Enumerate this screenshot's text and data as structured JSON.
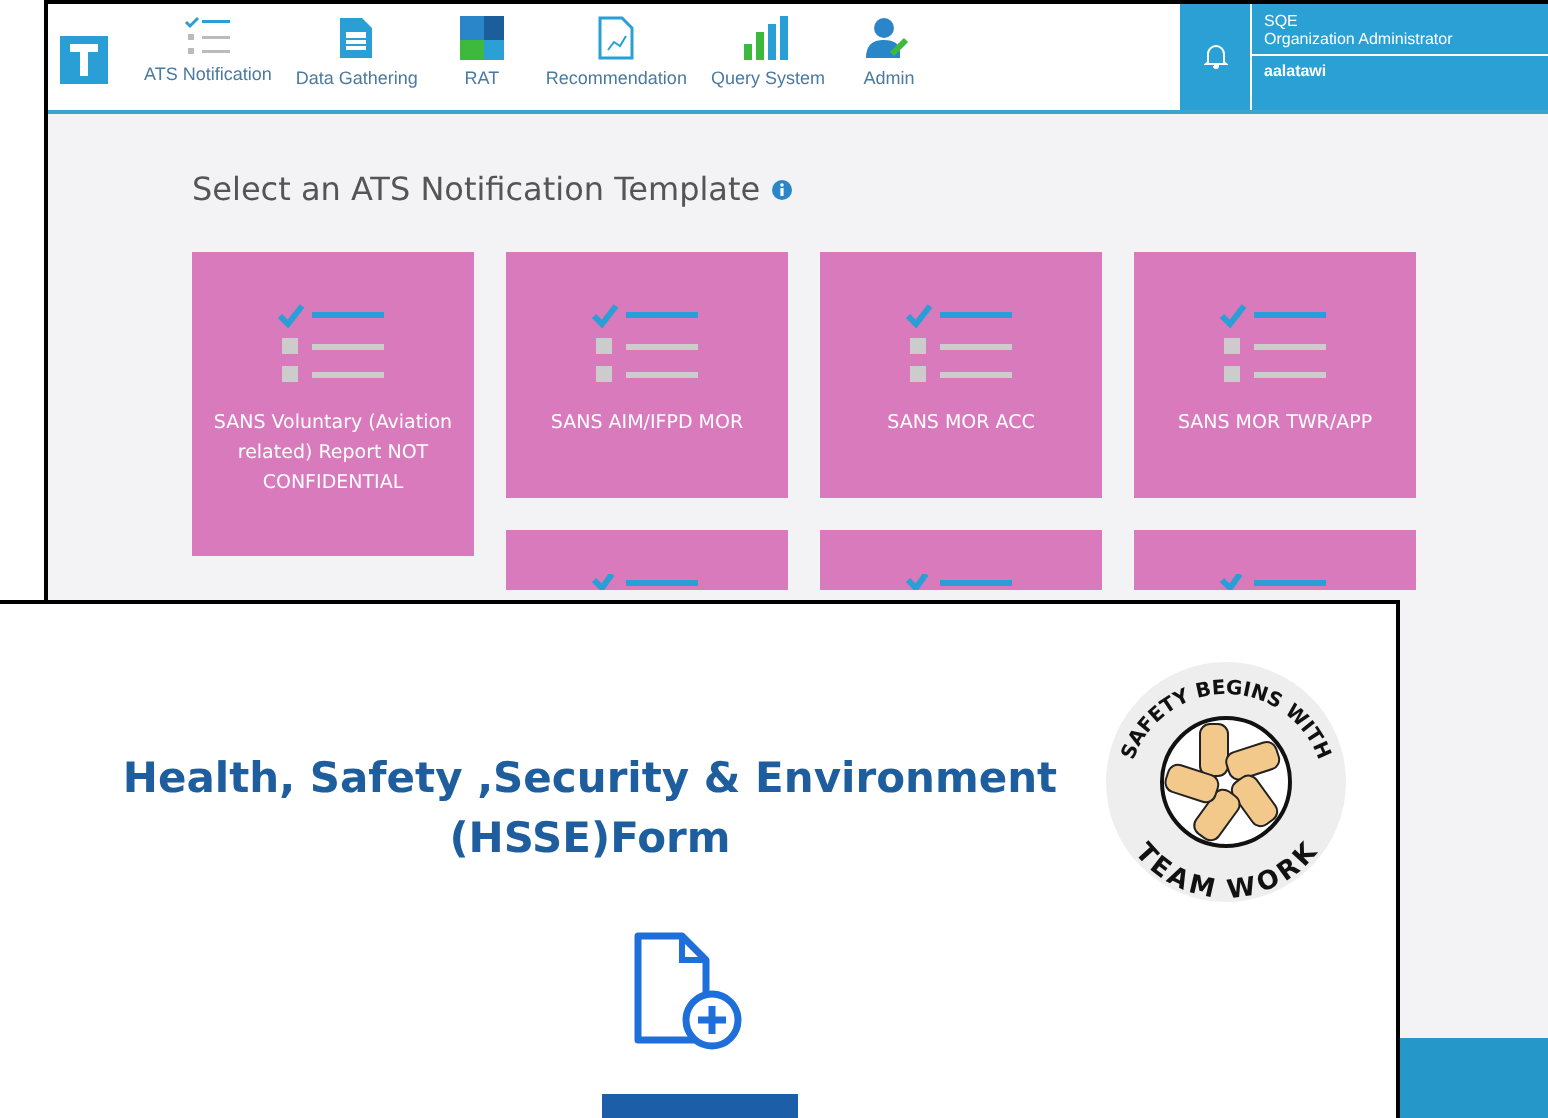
{
  "back_window": {
    "nav": [
      {
        "label": "ATS Notification",
        "kind": "checklist"
      },
      {
        "label": "Data Gathering",
        "kind": "document"
      },
      {
        "label": "RAT",
        "kind": "tiles"
      },
      {
        "label": "Recommendation",
        "kind": "report"
      },
      {
        "label": "Query System",
        "kind": "bars"
      },
      {
        "label": "Admin",
        "kind": "user"
      }
    ],
    "account": {
      "organization": "SQE",
      "role": "Organization Administrator",
      "user": "aalatawi"
    },
    "heading": "Select an ATS Notification Template",
    "cards": [
      {
        "kind": "template",
        "label": "SANS Voluntary (Aviation related) Report NOT CONFIDENTIAL"
      },
      {
        "kind": "template",
        "label": "SANS AIM/IFPD MOR"
      },
      {
        "kind": "template",
        "label": "SANS MOR ACC"
      },
      {
        "kind": "template",
        "label": "SANS MOR TWR/APP"
      },
      {
        "kind": "covered"
      },
      {
        "kind": "covered"
      },
      {
        "kind": "covered"
      }
    ]
  },
  "front_window": {
    "title": "Health, Safety ,Security & Environment (HSSE)Form",
    "badge": {
      "top": "SAFETY BEGINS WITH",
      "bottom": "TEAM WORK"
    }
  }
}
